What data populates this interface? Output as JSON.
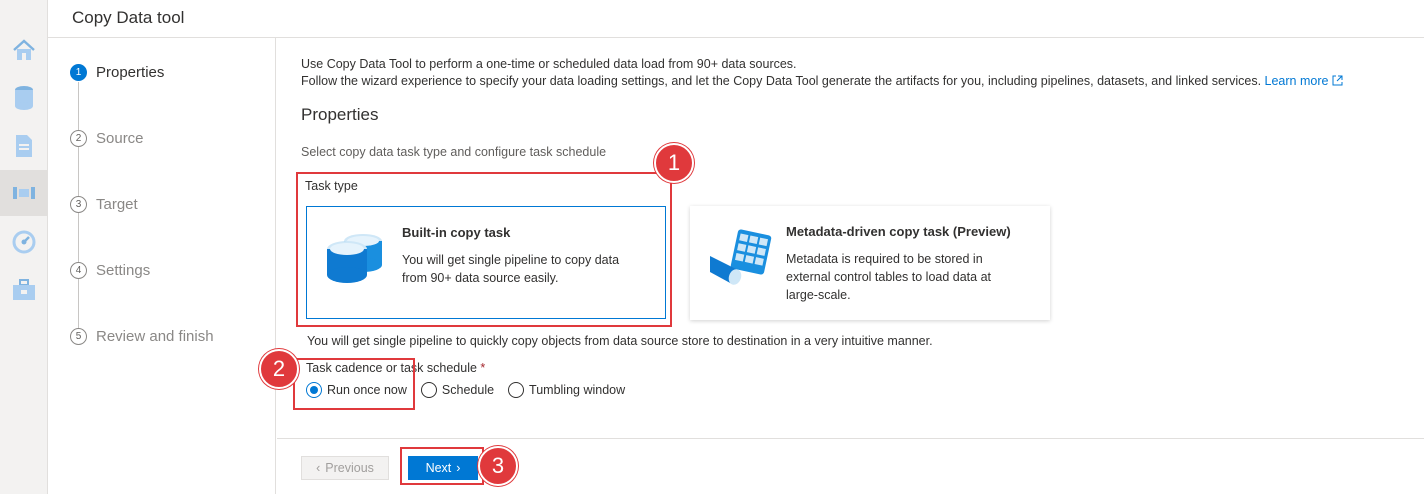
{
  "header": {
    "title": "Copy Data tool"
  },
  "rail": {
    "icons": [
      "home-icon",
      "data-icon",
      "document-icon",
      "pipeline-icon",
      "monitor-icon",
      "manage-icon"
    ]
  },
  "steps": [
    {
      "num": "1",
      "label": "Properties",
      "active": true
    },
    {
      "num": "2",
      "label": "Source",
      "active": false
    },
    {
      "num": "3",
      "label": "Target",
      "active": false
    },
    {
      "num": "4",
      "label": "Settings",
      "active": false
    },
    {
      "num": "5",
      "label": "Review and finish",
      "active": false
    }
  ],
  "intro": {
    "line1": "Use Copy Data Tool to perform a one-time or scheduled data load from 90+ data sources.",
    "line2": "Follow the wizard experience to specify your data loading settings, and let the Copy Data Tool generate the artifacts for you, including pipelines, datasets, and linked services.",
    "learn_more": "Learn more"
  },
  "properties": {
    "title": "Properties",
    "description": "Select copy data task type and configure task schedule",
    "task_type_label": "Task type",
    "cards": [
      {
        "title": "Built-in copy task",
        "description": "You will get single pipeline to copy data from 90+ data source easily.",
        "selected": true
      },
      {
        "title": "Metadata-driven copy task (Preview)",
        "description": "Metadata is required to be stored in external control tables to load data at large-scale.",
        "selected": false
      }
    ],
    "hint": "You will get single pipeline to quickly copy objects from data source store to destination in a very intuitive manner.",
    "cadence_label": "Task cadence or task schedule",
    "required_mark": "*",
    "cadence_options": [
      {
        "label": "Run once now",
        "checked": true
      },
      {
        "label": "Schedule",
        "checked": false
      },
      {
        "label": "Tumbling window",
        "checked": false
      }
    ]
  },
  "footer": {
    "previous_label": "Previous",
    "next_label": "Next"
  },
  "callouts": [
    "1",
    "2",
    "3"
  ],
  "colors": {
    "accent": "#0078d4",
    "callout": "#e0393c",
    "rail_bg": "#f3f2f1"
  }
}
